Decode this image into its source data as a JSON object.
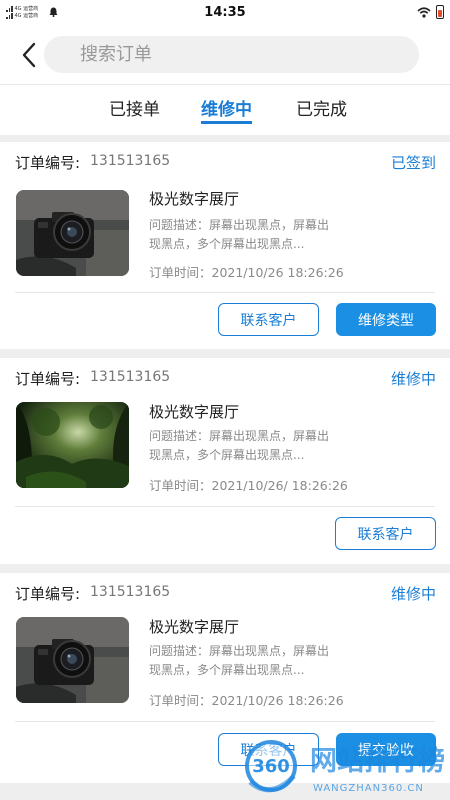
{
  "status_bar": {
    "time": "14:35",
    "network": "4G 运营商"
  },
  "header": {
    "search_placeholder": "搜索订单"
  },
  "tabs": [
    {
      "label": "已接单",
      "active": false
    },
    {
      "label": "维修中",
      "active": true
    },
    {
      "label": "已完成",
      "active": false
    }
  ],
  "orders": [
    {
      "order_label": "订单编号:",
      "order_no": "131513165",
      "status": "已签到",
      "image": "camera-photo",
      "shop": "极光数字展厅",
      "desc": "问题描述：屏幕出现黑点，屏幕出现黑点，多个屏幕出现黑点...",
      "time": "订单时间：2021/10/26  18:26:26",
      "buttons": [
        {
          "label": "联系客户",
          "style": "outline"
        },
        {
          "label": "维修类型",
          "style": "solid"
        }
      ]
    },
    {
      "order_label": "订单编号:",
      "order_no": "131513165",
      "status": "维修中",
      "image": "forest-photo",
      "shop": "极光数字展厅",
      "desc": "问题描述：屏幕出现黑点，屏幕出现黑点，多个屏幕出现黑点...",
      "time": "订单时间：2021/10/26/  18:26:26",
      "buttons": [
        {
          "label": "联系客户",
          "style": "outline"
        }
      ]
    },
    {
      "order_label": "订单编号:",
      "order_no": "131513165",
      "status": "维修中",
      "image": "camera-photo",
      "shop": "极光数字展厅",
      "desc": "问题描述：屏幕出现黑点，屏幕出现黑点，多个屏幕出现黑点...",
      "time": "订单时间：2021/10/26  18:26:26",
      "buttons": [
        {
          "label": "联系客户",
          "style": "outline"
        },
        {
          "label": "提交验收",
          "style": "solid"
        }
      ]
    }
  ],
  "watermark": {
    "badge": "360",
    "title": "网站排行榜",
    "url": "WANGZHAN360.CN"
  },
  "colors": {
    "accent": "#1a7ed6",
    "button_fill": "#1a8fe3",
    "background": "#eeeeee"
  }
}
